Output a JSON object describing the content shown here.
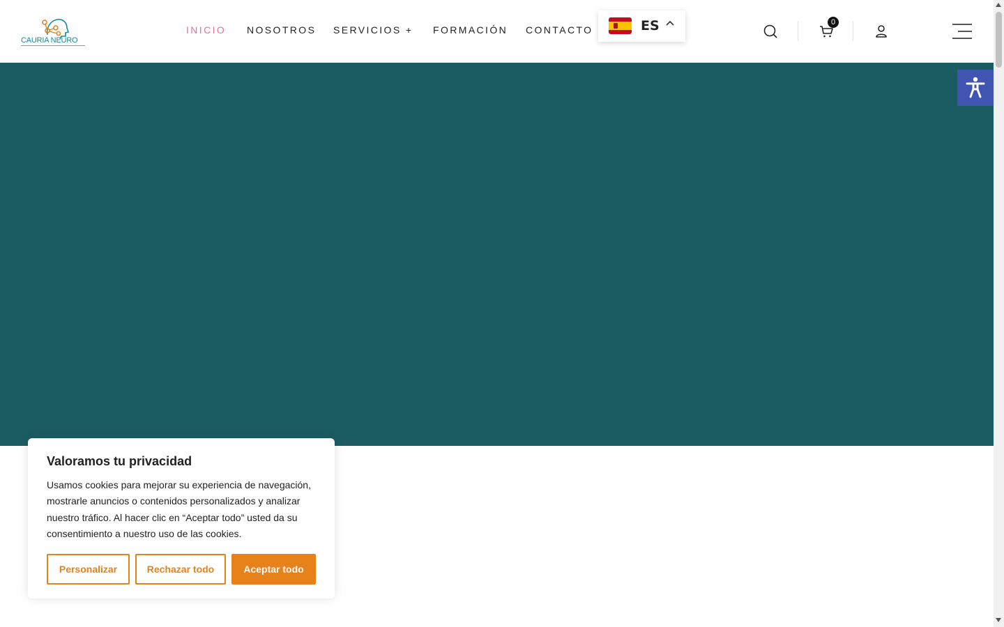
{
  "header": {
    "logo": {
      "text": "CAURIA NEURO"
    },
    "nav": [
      {
        "label": "INICIO",
        "active": true
      },
      {
        "label": "NOSOTROS"
      },
      {
        "label": "SERVICIOS +"
      },
      {
        "label": "FORMACIÓN"
      },
      {
        "label": "CONTACTO"
      }
    ],
    "language": {
      "code": "ES",
      "flag": "spain-flag-icon"
    },
    "icons": [
      "search-icon",
      "cart-icon",
      "user-icon",
      "menu-icon"
    ],
    "cart_count": "0"
  },
  "colors": {
    "hero_bg": "#1b5c62",
    "accent": "#e7811a",
    "nav_active": "#e36f98",
    "accessibility_bg": "#4054b2"
  },
  "cookie": {
    "title": "Valoramos tu privacidad",
    "text": "Usamos cookies para mejorar su experiencia de navegación, mostrarle anuncios o contenidos personalizados y analizar nuestro tráfico. Al hacer clic en “Aceptar todo” usted da su consentimiento a nuestro uso de las cookies.",
    "buttons": {
      "customize": "Personalizar",
      "reject": "Rechazar todo",
      "accept": "Aceptar todo"
    }
  }
}
